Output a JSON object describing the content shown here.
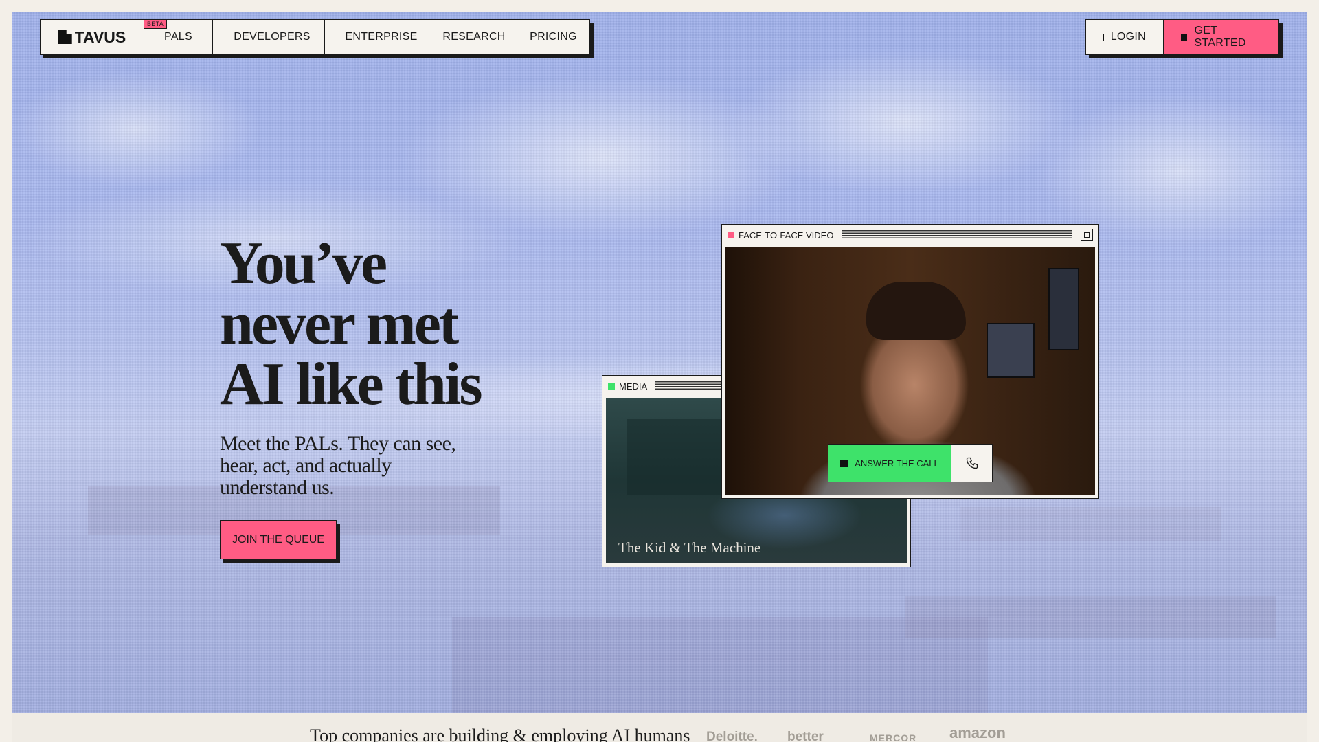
{
  "nav": {
    "logo": "TAVUS",
    "beta_badge": "BETA",
    "items": [
      {
        "label": "PALS",
        "icon": ""
      },
      {
        "label": "DEVELOPERS",
        "icon": "square-icon"
      },
      {
        "label": "ENTERPRISE",
        "icon": "square-icon"
      },
      {
        "label": "RESEARCH",
        "icon": ""
      },
      {
        "label": "PRICING",
        "icon": ""
      }
    ],
    "login": "LOGIN",
    "get_started": "GET STARTED"
  },
  "hero": {
    "headline_line1": "You’ve",
    "headline_line2": "never met",
    "headline_line3": "AI like this",
    "subheadline": "Meet the PALs. They can see, hear, act, and actually understand us.",
    "cta": "JOIN THE QUEUE"
  },
  "media_window": {
    "title": "MEDIA",
    "caption": "The Kid & The Machine",
    "indicator_color": "#3ee26a"
  },
  "video_window": {
    "title": "FACE-TO-FACE VIDEO",
    "indicator_color": "#ff5c84",
    "answer_label": "ANSWER THE CALL",
    "phone_icon": "phone-icon"
  },
  "companies": {
    "tagline": "Top companies are building & employing AI humans",
    "logos": [
      "Deloitte.",
      "better",
      "MERCOR",
      "amazon"
    ]
  },
  "colors": {
    "accent_pink": "#ff5c84",
    "accent_green": "#3ee26a",
    "ink": "#1a1a1a",
    "paper": "#f6f3ee"
  }
}
